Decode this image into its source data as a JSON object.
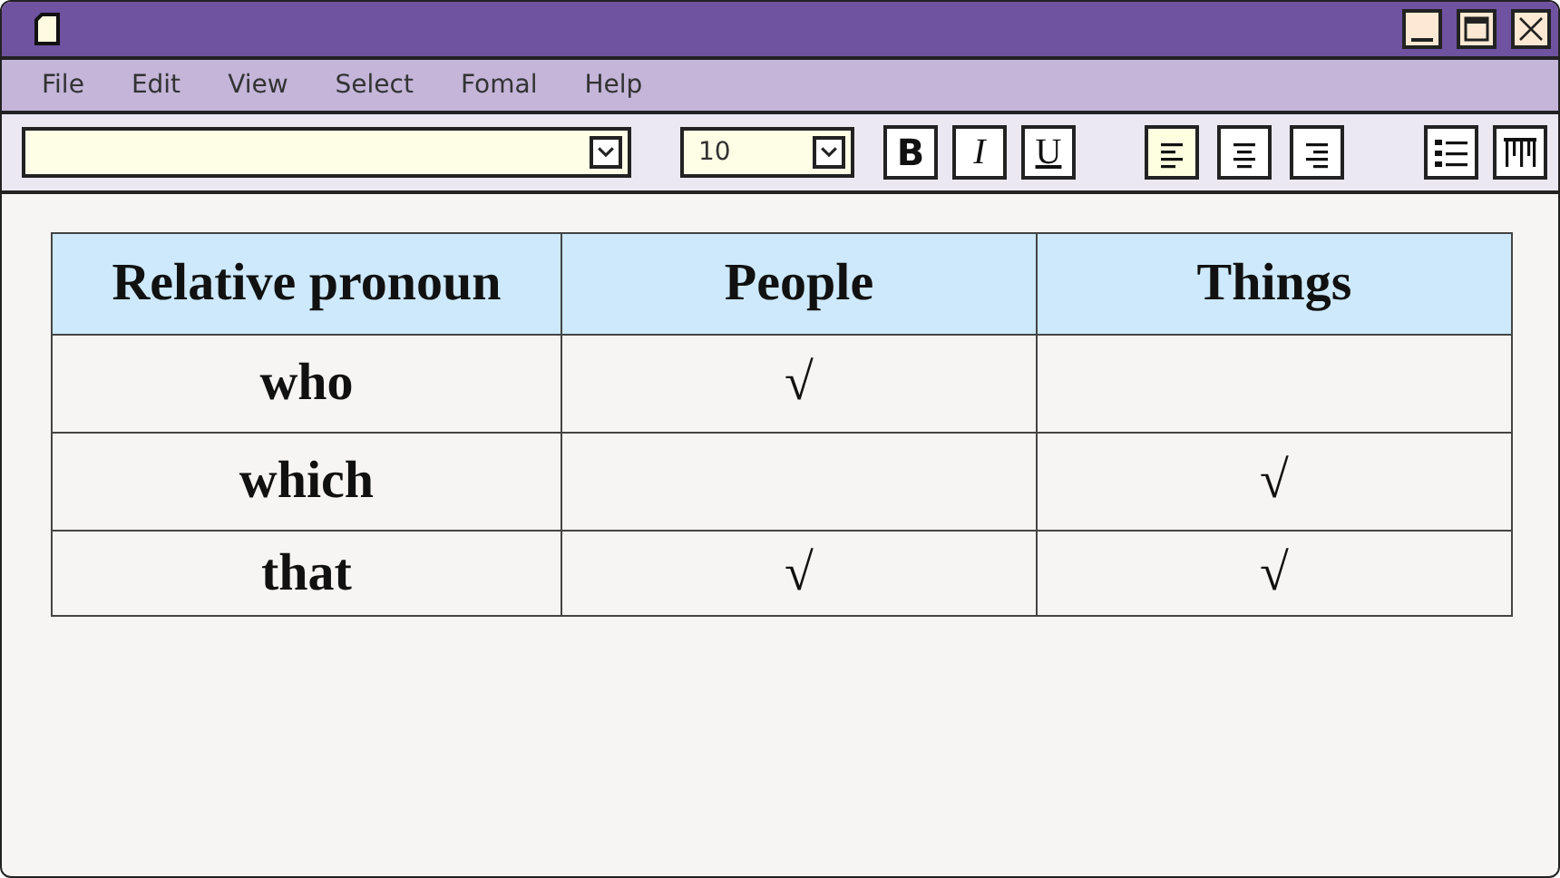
{
  "menu": [
    "File",
    "Edit",
    "View",
    "Select",
    "Fomal",
    "Help"
  ],
  "toolbar": {
    "size_field": {
      "value": "10"
    },
    "format_buttons": [
      {
        "label": "B",
        "kind": "bold"
      },
      {
        "label": "I",
        "kind": "italic"
      },
      {
        "label": "U",
        "kind": "underline"
      }
    ],
    "align_buttons": [
      {
        "kind": "left",
        "selected": true
      },
      {
        "kind": "center",
        "selected": false
      },
      {
        "kind": "right",
        "selected": false
      }
    ]
  },
  "table": {
    "columns": [
      "Relative pronoun",
      "People",
      "Things"
    ],
    "rows": [
      [
        "who",
        "√",
        null
      ],
      [
        "which",
        null,
        "√"
      ],
      [
        "that",
        "√",
        "√"
      ]
    ]
  }
}
